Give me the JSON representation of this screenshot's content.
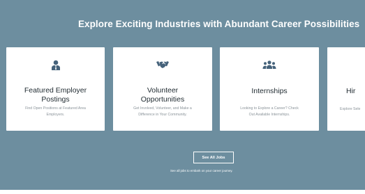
{
  "section": {
    "title": "Explore Exciting Industries with Abundant Career Possibilities"
  },
  "cards": [
    {
      "icon": "employer-icon",
      "title_line1": "Featured Employer",
      "title_line2": "Postings",
      "desc_line1": "Find Open Positions at Featured Area",
      "desc_line2": "Employers."
    },
    {
      "icon": "handshake-icon",
      "title_line1": "Volunteer",
      "title_line2": "Opportunities",
      "desc_line1": "Get Involved, Volunteer, and Make a",
      "desc_line2": "Difference in Your Community."
    },
    {
      "icon": "group-icon",
      "title_line1": "Internships",
      "title_line2": "",
      "desc_line1": "Looking to Explore a Career? Check",
      "desc_line2": "Out Available Internships."
    },
    {
      "icon": "hiring-icon",
      "title_line1": "Hir",
      "title_line2": "",
      "desc_line1": "Explore Sele",
      "desc_line2": ""
    }
  ],
  "cta": {
    "label": "See All Jobs",
    "caption": "See all jobs to embark on your career journey."
  },
  "colors": {
    "panel": "#6d8e9f",
    "icon": "#45627a"
  }
}
